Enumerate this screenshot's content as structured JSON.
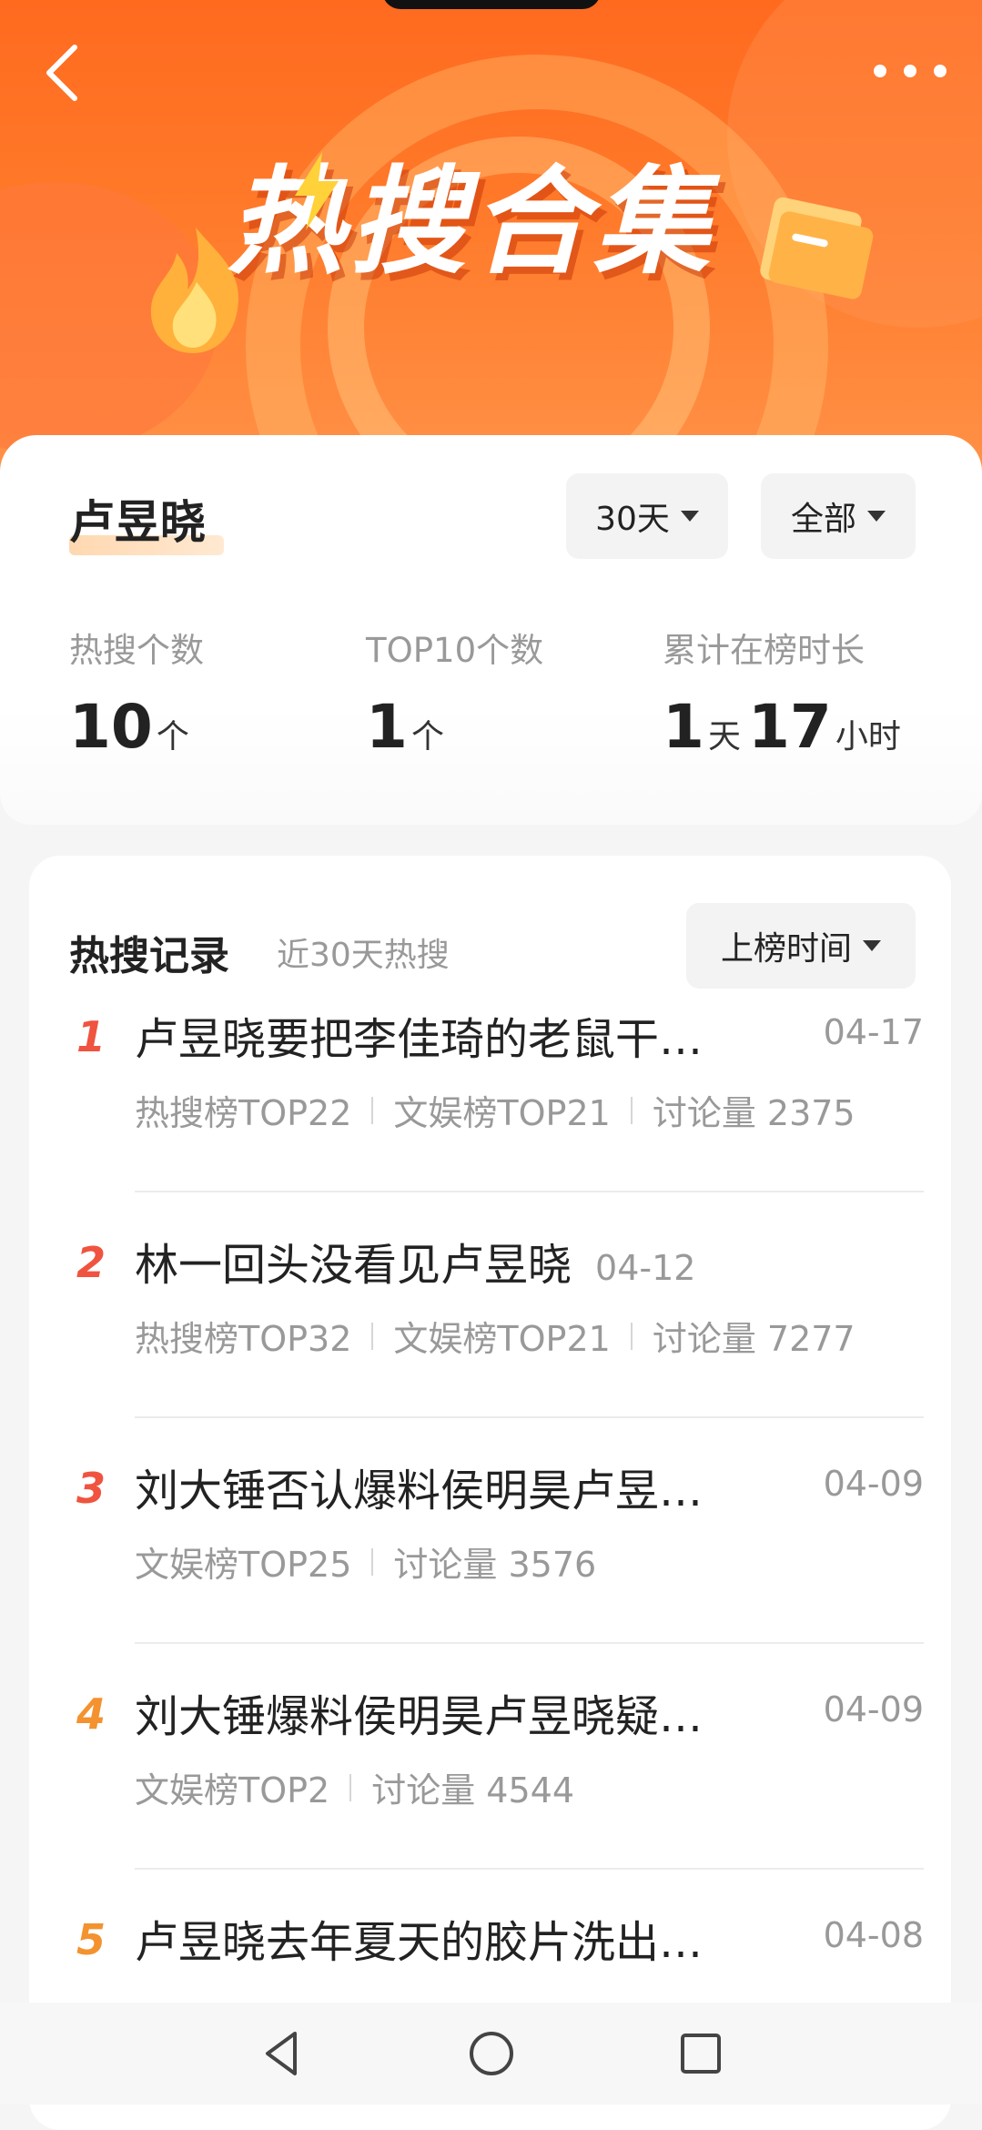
{
  "banner": {
    "title": "热搜合集",
    "back_icon": "back-icon",
    "more_icon": "more-icon"
  },
  "profile": {
    "name": "卢昱晓",
    "filter_days": "30天",
    "filter_type": "全部",
    "stats": [
      {
        "label": "热搜个数",
        "value": "10",
        "unit": "个"
      },
      {
        "label": "TOP10个数",
        "value": "1",
        "unit": "个"
      },
      {
        "label": "累计在榜时长",
        "value1": "1",
        "unit1": "天",
        "value2": "17",
        "unit2": "小时"
      }
    ]
  },
  "records": {
    "title": "热搜记录",
    "subtitle": "近30天热搜",
    "sort_label": "上榜时间",
    "items": [
      {
        "rank": "1",
        "title": "卢昱晓要把李佳琦的老鼠干…",
        "date": "04-17",
        "meta": [
          "热搜榜TOP22",
          "文娱榜TOP21",
          "讨论量 2375"
        ]
      },
      {
        "rank": "2",
        "title": "林一回头没看见卢昱晓",
        "date": "04-12",
        "meta": [
          "热搜榜TOP32",
          "文娱榜TOP21",
          "讨论量 7277"
        ]
      },
      {
        "rank": "3",
        "title": "刘大锤否认爆料侯明昊卢昱…",
        "date": "04-09",
        "meta": [
          "文娱榜TOP25",
          "讨论量 3576"
        ]
      },
      {
        "rank": "4",
        "title": "刘大锤爆料侯明昊卢昱晓疑…",
        "date": "04-09",
        "meta": [
          "文娱榜TOP2",
          "讨论量 4544"
        ]
      },
      {
        "rank": "5",
        "title": "卢昱晓去年夏天的胶片洗出…",
        "date": "04-08",
        "meta": []
      }
    ]
  },
  "colors": {
    "rank_top": "#f0533f",
    "rank_other": "#f3922f",
    "banner": "#ff6a1f"
  }
}
